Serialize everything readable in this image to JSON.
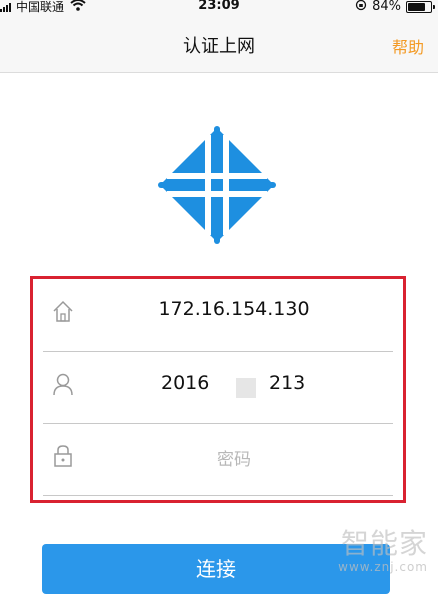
{
  "status_bar": {
    "carrier": "中国联通",
    "time": "23:09",
    "battery_percent": "84%",
    "battery_level": 0.84
  },
  "nav": {
    "title": "认证上网",
    "help_label": "帮助"
  },
  "form": {
    "server_value": "172.16.154.130",
    "username_left": "2016",
    "username_right": "213",
    "password_placeholder": "密码"
  },
  "connect_label": "连接",
  "watermark": {
    "text_cn": "智能家",
    "text_en": "www.znj.com"
  },
  "colors": {
    "accent_blue": "#2b97ea",
    "logo_blue": "#1e8fe0",
    "help_orange": "#f39a24",
    "highlight_red": "#d92231"
  }
}
